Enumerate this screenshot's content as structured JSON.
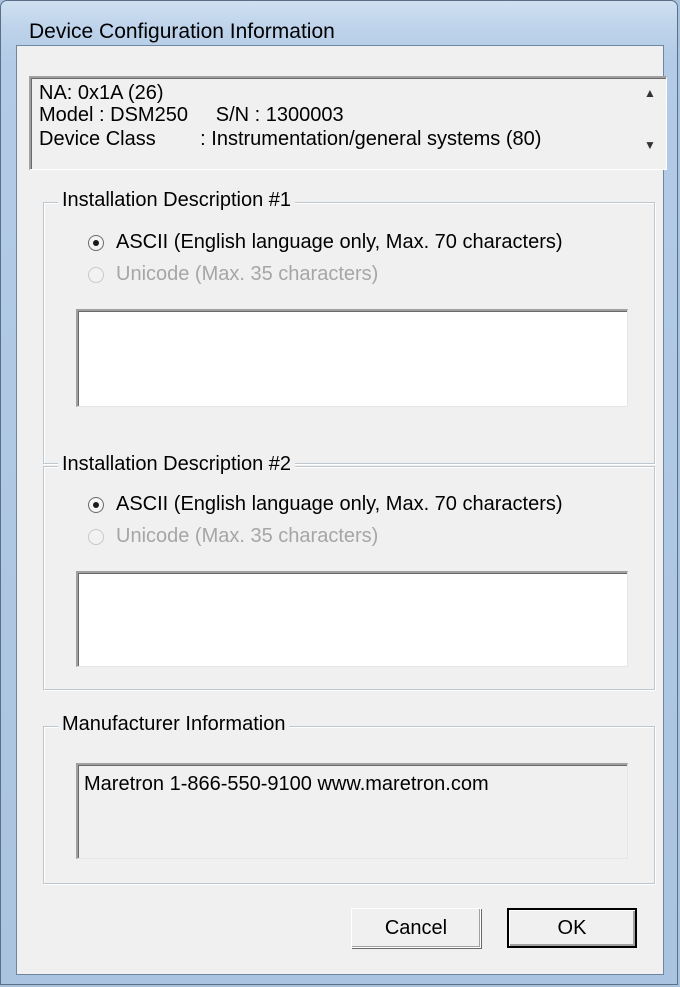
{
  "window": {
    "title": "Device Configuration Information"
  },
  "info": {
    "line1": "NA: 0x1A (26)",
    "line2": "Model : DSM250     S/N : 1300003",
    "line3": "Device Class        : Instrumentation/general systems (80)"
  },
  "install1": {
    "legend": "Installation Description #1",
    "ascii_label": "ASCII (English language only, Max. 70 characters)",
    "unicode_label": "Unicode (Max. 35 characters)",
    "value": ""
  },
  "install2": {
    "legend": "Installation Description #2",
    "ascii_label": "ASCII (English language only, Max. 70 characters)",
    "unicode_label": "Unicode (Max. 35 characters)",
    "value": ""
  },
  "manufacturer": {
    "legend": "Manufacturer Information",
    "value": "Maretron 1-866-550-9100 www.maretron.com"
  },
  "buttons": {
    "cancel": "Cancel",
    "ok": "OK"
  },
  "icons": {
    "scroll_up": "scroll-up-arrow-icon",
    "scroll_down": "scroll-down-arrow-icon"
  }
}
